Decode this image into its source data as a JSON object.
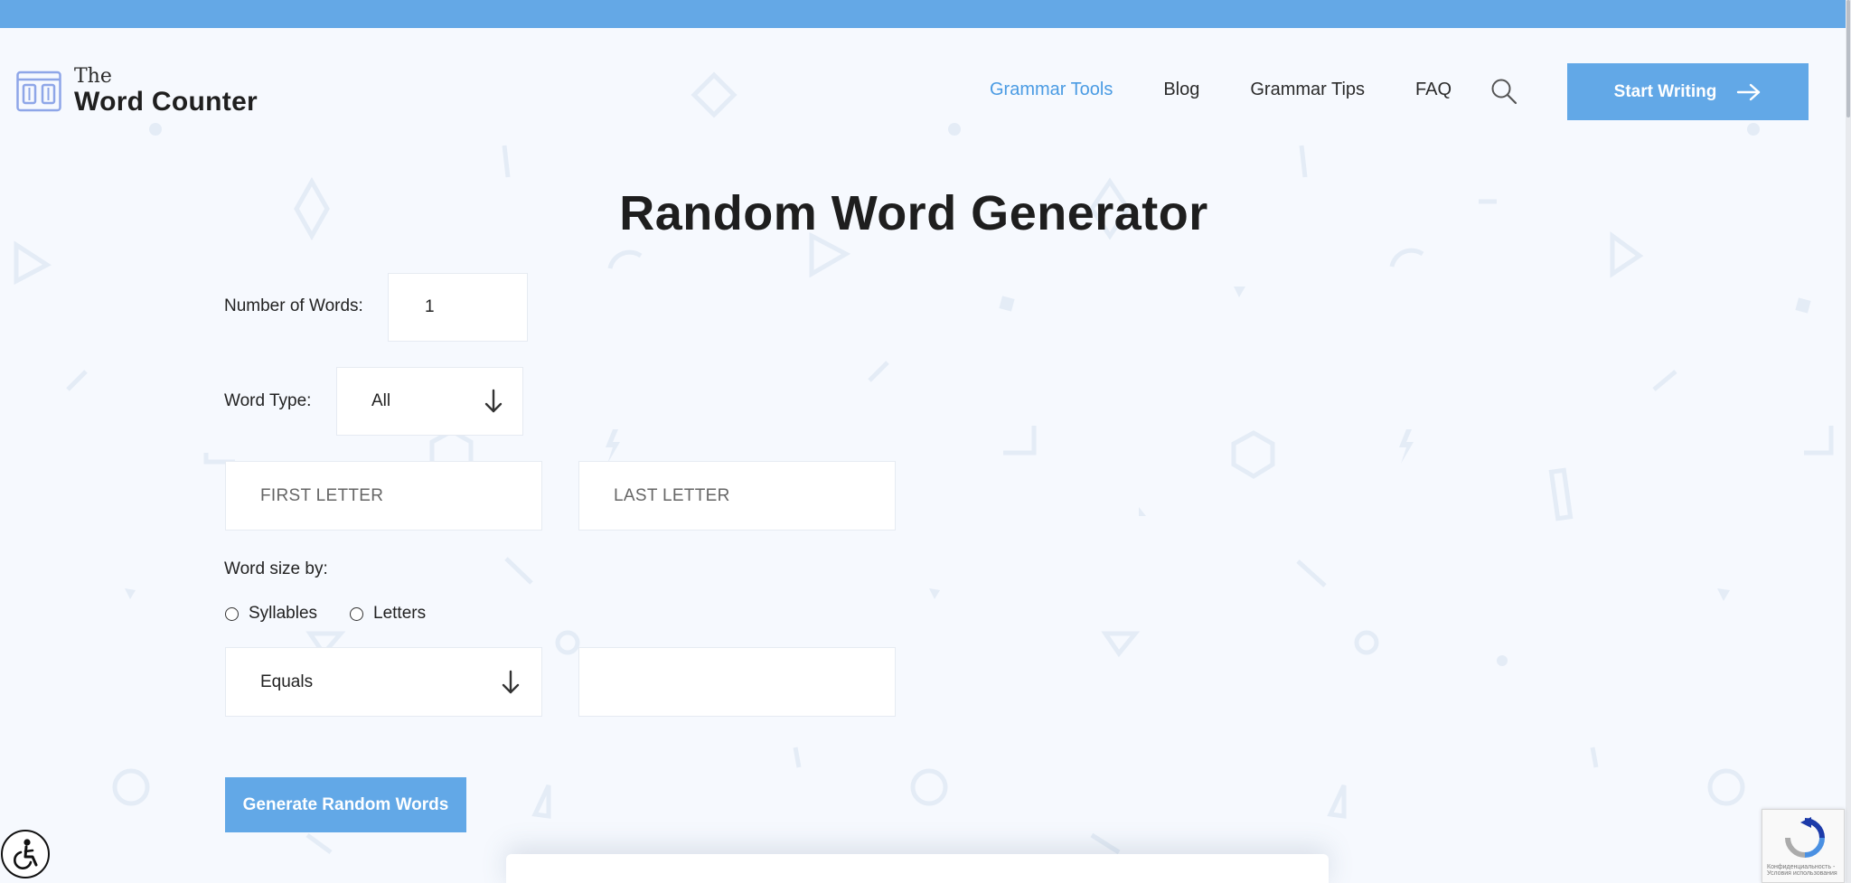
{
  "brand": {
    "logo_small": "The",
    "logo_large": "Word Counter"
  },
  "nav": {
    "items": [
      {
        "label": "Grammar Tools",
        "active": true
      },
      {
        "label": "Blog",
        "active": false
      },
      {
        "label": "Grammar Tips",
        "active": false
      },
      {
        "label": "FAQ",
        "active": false
      }
    ],
    "search_icon": "search-icon",
    "cta_label": "Start Writing",
    "cta_icon": "arrow-right-icon"
  },
  "page": {
    "title": "Random Word Generator"
  },
  "form": {
    "number_of_words_label": "Number of Words:",
    "number_of_words_value": "1",
    "word_type_label": "Word Type:",
    "word_type_value": "All",
    "first_letter_placeholder": "FIRST LETTER",
    "last_letter_placeholder": "LAST LETTER",
    "word_size_label": "Word size by:",
    "radio_syllables": "Syllables",
    "radio_letters": "Letters",
    "comparison_value": "Equals",
    "size_value": "",
    "generate_label": "Generate Random Words"
  },
  "widgets": {
    "accessibility_icon": "accessibility-icon",
    "recaptcha_icon": "recaptcha-icon",
    "recaptcha_text_line1": "Конфиденциальность -",
    "recaptcha_text_line2": "Условия использования"
  },
  "colors": {
    "accent": "#62a8e7",
    "nav_active": "#4a9be3",
    "topbar": "#64a8e6",
    "background": "#f6f9fe"
  }
}
